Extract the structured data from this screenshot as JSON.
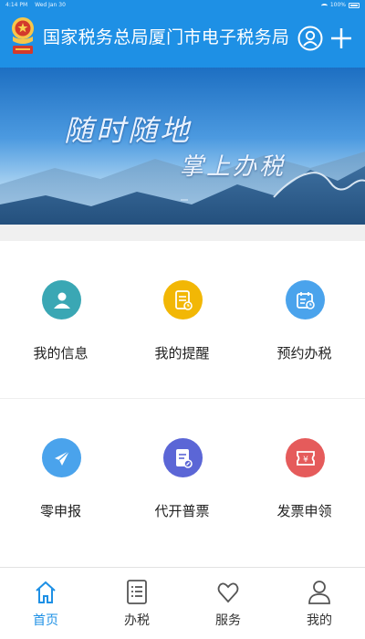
{
  "status_bar": {
    "time": "4:14 PM",
    "date": "Wed Jan 30",
    "battery": "100%"
  },
  "header": {
    "title": "国家税务总局厦门市电子税务局"
  },
  "banner": {
    "line1": "随时随地",
    "line2": "掌上办税"
  },
  "colors": {
    "primary": "#1e90e5",
    "teal": "#3aa7b4",
    "yellow": "#f2b705",
    "lightblue": "#4aa3ec",
    "indigo": "#5b66d6",
    "red": "#e55b5b"
  },
  "grid": {
    "tiles": [
      {
        "label": "我的信息",
        "icon": "person-icon"
      },
      {
        "label": "我的提醒",
        "icon": "reminder-document-icon"
      },
      {
        "label": "预约办税",
        "icon": "calendar-icon"
      },
      {
        "label": "零申报",
        "icon": "paper-plane-icon"
      },
      {
        "label": "代开普票",
        "icon": "invoice-edit-icon"
      },
      {
        "label": "发票申领",
        "icon": "yen-ticket-icon"
      }
    ]
  },
  "tabbar": {
    "tabs": [
      {
        "label": "首页",
        "icon": "home-icon",
        "active": true
      },
      {
        "label": "办税",
        "icon": "list-icon",
        "active": false
      },
      {
        "label": "服务",
        "icon": "heart-icon",
        "active": false
      },
      {
        "label": "我的",
        "icon": "profile-icon",
        "active": false
      }
    ]
  }
}
